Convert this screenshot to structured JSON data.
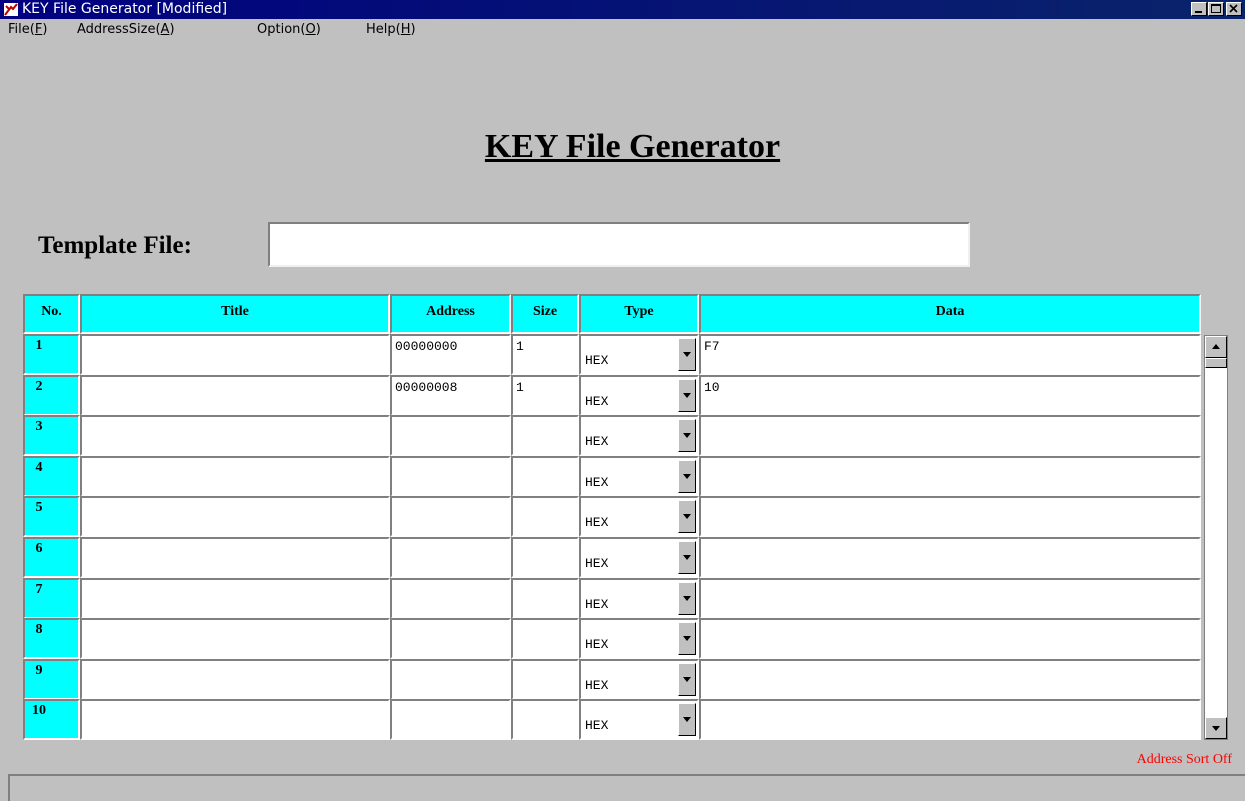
{
  "window": {
    "title": "KEY File Generator [Modified]"
  },
  "menu": [
    {
      "label": "File(",
      "key": "F",
      "suffix": ")"
    },
    {
      "label": "AddressSize(",
      "key": "A",
      "suffix": ")"
    },
    {
      "label": "Option(",
      "key": "O",
      "suffix": ")"
    },
    {
      "label": "Help(",
      "key": "H",
      "suffix": ")"
    }
  ],
  "heading": "KEY File Generator",
  "template": {
    "label": "Template File:",
    "value": ""
  },
  "table": {
    "headers": {
      "no": "No.",
      "title": "Title",
      "address": "Address",
      "size": "Size",
      "type": "Type",
      "data": "Data"
    },
    "rows": [
      {
        "no": "1",
        "title": "",
        "address": "00000000",
        "size": "1",
        "type": "HEX",
        "data": "F7"
      },
      {
        "no": "2",
        "title": "",
        "address": "00000008",
        "size": "1",
        "type": "HEX",
        "data": "10"
      },
      {
        "no": "3",
        "title": "",
        "address": "",
        "size": "",
        "type": "HEX",
        "data": ""
      },
      {
        "no": "4",
        "title": "",
        "address": "",
        "size": "",
        "type": "HEX",
        "data": ""
      },
      {
        "no": "5",
        "title": "",
        "address": "",
        "size": "",
        "type": "HEX",
        "data": ""
      },
      {
        "no": "6",
        "title": "",
        "address": "",
        "size": "",
        "type": "HEX",
        "data": ""
      },
      {
        "no": "7",
        "title": "",
        "address": "",
        "size": "",
        "type": "HEX",
        "data": ""
      },
      {
        "no": "8",
        "title": "",
        "address": "",
        "size": "",
        "type": "HEX",
        "data": ""
      },
      {
        "no": "9",
        "title": "",
        "address": "",
        "size": "",
        "type": "HEX",
        "data": ""
      },
      {
        "no": "10",
        "title": "",
        "address": "",
        "size": "",
        "type": "HEX",
        "data": ""
      }
    ]
  },
  "sort_status": "Address Sort Off",
  "colors": {
    "header_bg": "#00ffff",
    "titlebar_bg": "#000080",
    "sort_status": "#ff0000"
  },
  "icons": {
    "app": "app-icon",
    "minimize": "minimize-icon",
    "maximize": "maximize-icon",
    "close": "close-icon",
    "dropdown": "chevron-down-icon",
    "scroll_up": "scroll-up-icon",
    "scroll_down": "scroll-down-icon"
  }
}
